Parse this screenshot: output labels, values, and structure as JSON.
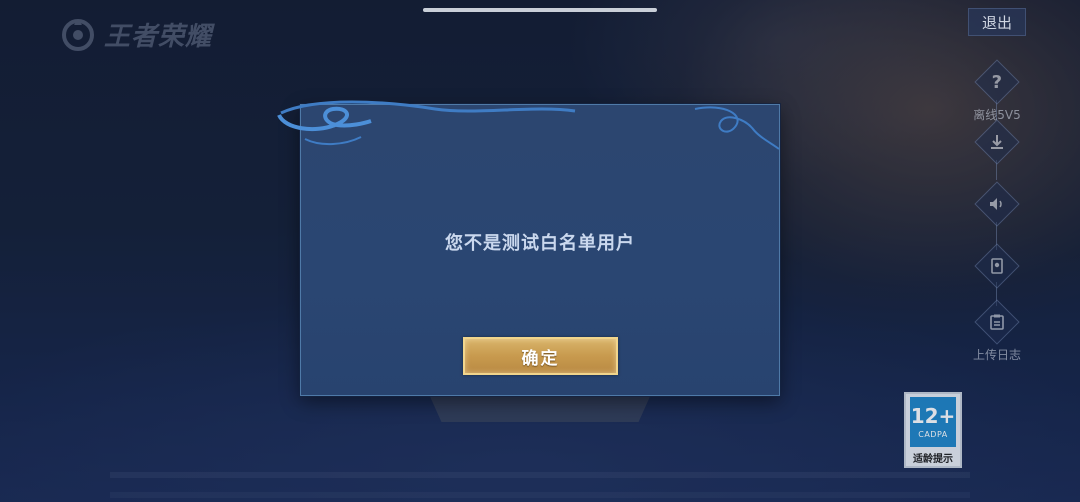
{
  "app": {
    "logo_text": "王者荣耀",
    "exit_label": "退出"
  },
  "side_menu": {
    "items": [
      {
        "icon": "question-icon",
        "label": "离线5V5"
      },
      {
        "icon": "download-icon",
        "label": ""
      },
      {
        "icon": "speaker-icon",
        "label": ""
      },
      {
        "icon": "card-icon",
        "label": ""
      },
      {
        "icon": "clipboard-icon",
        "label": "上传日志"
      }
    ]
  },
  "dialog": {
    "message": "您不是测试白名单用户",
    "confirm_label": "确定"
  },
  "rating_badge": {
    "age": "12+",
    "org": "CADPA",
    "note": "适龄提示"
  },
  "colors": {
    "dialog_bg": "#2a4672",
    "dialog_border": "#4f7aa8",
    "button_gold": "#c89a4e",
    "message_text": "#cad8ee"
  }
}
